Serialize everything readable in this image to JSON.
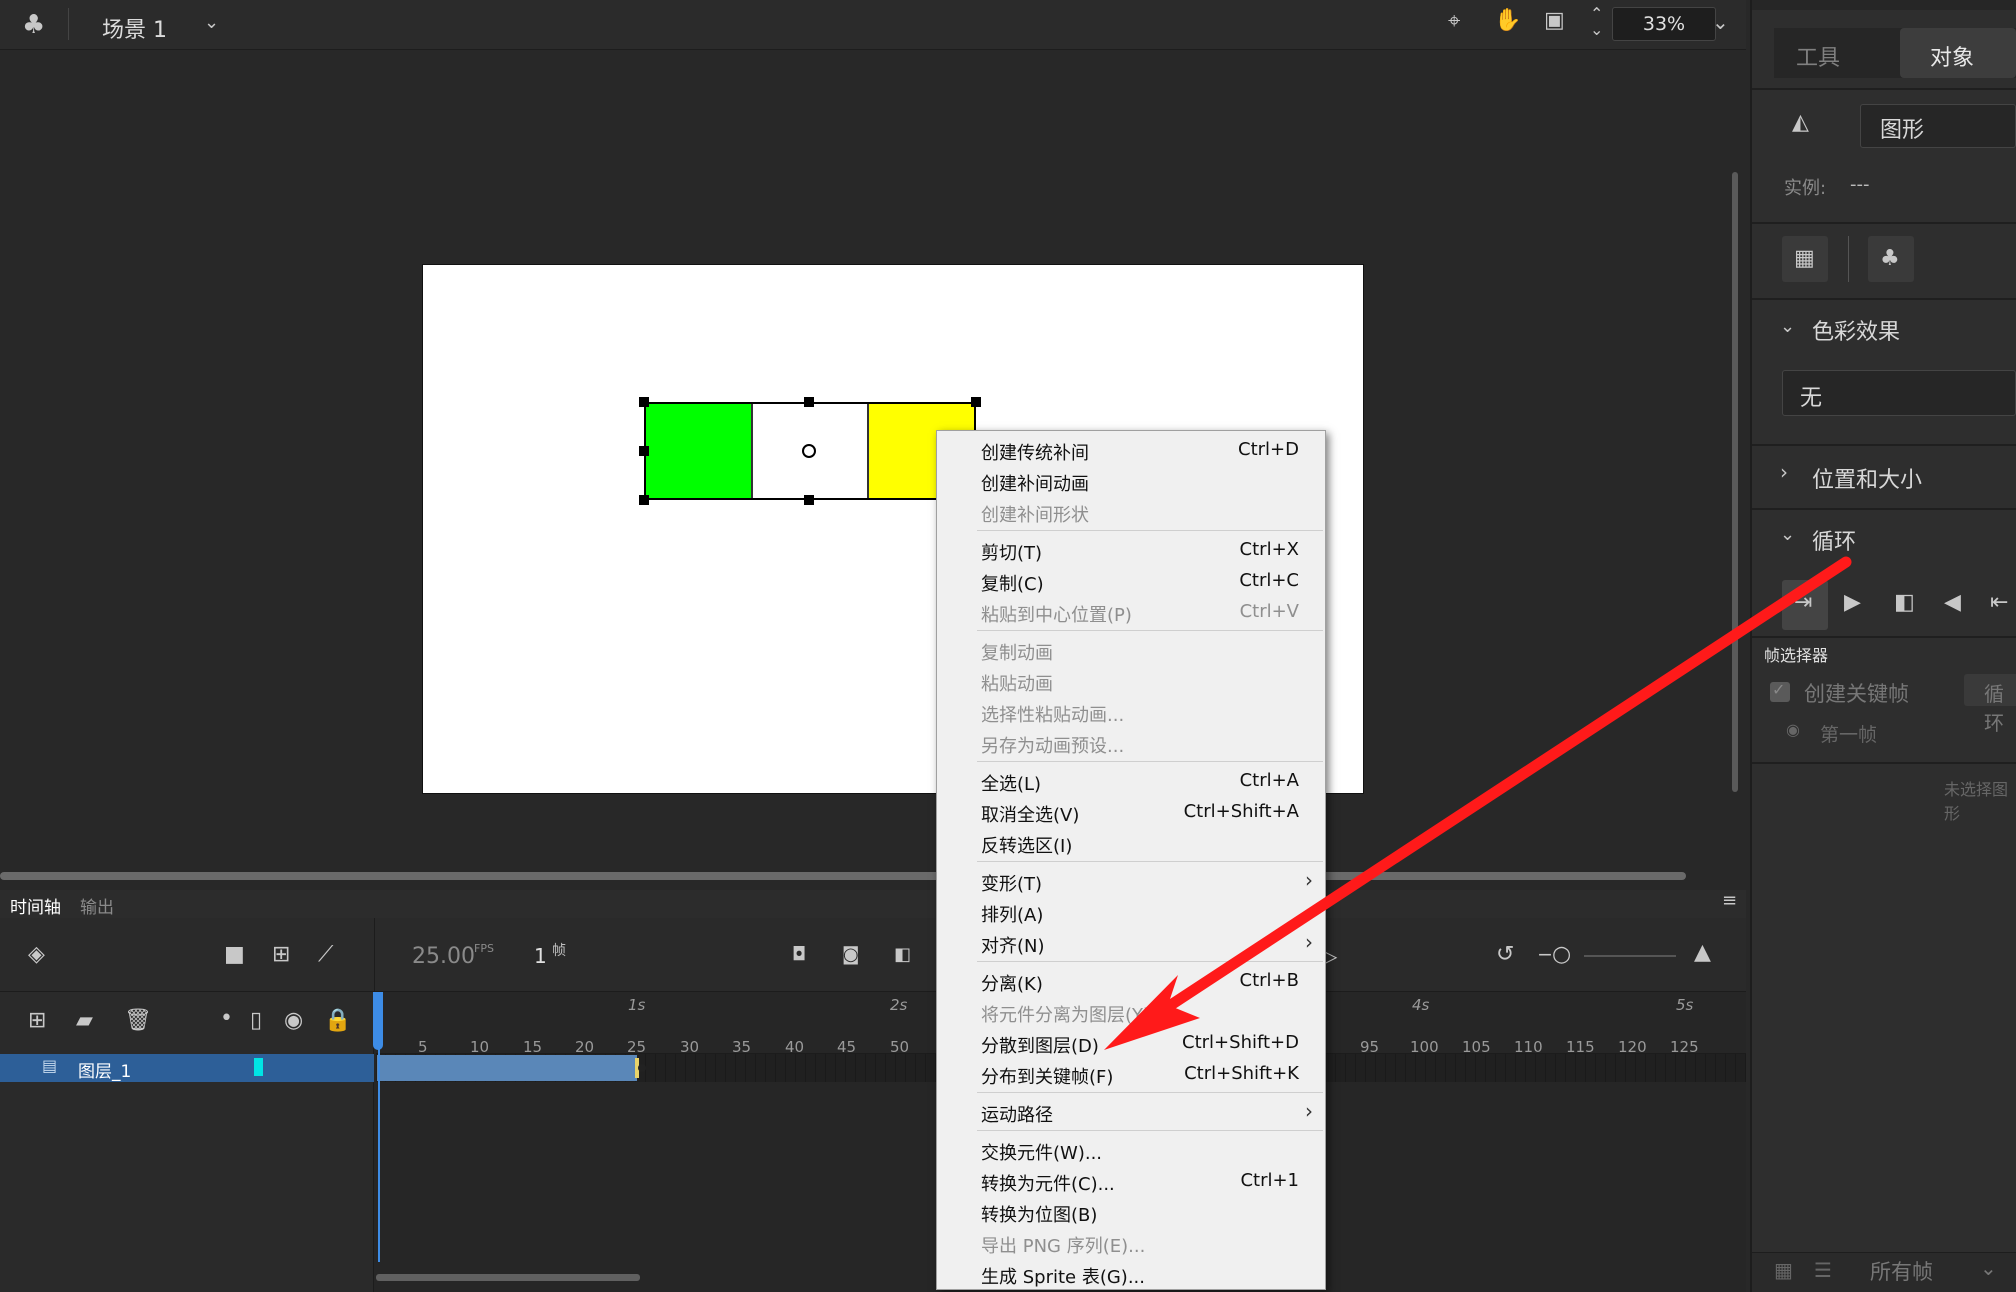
{
  "topbar": {
    "scene_label": "场景 1",
    "zoom": "33%"
  },
  "timeline": {
    "tab_timeline": "时间轴",
    "tab_output": "输出",
    "fps": "25.00",
    "fps_unit": "FPS",
    "frame": "1",
    "frame_unit": "帧",
    "layer_name": "图层_1",
    "seconds": [
      "1s",
      "2s",
      "4s",
      "5s"
    ],
    "ticks_left": [
      "5",
      "10",
      "15",
      "20",
      "25",
      "30",
      "35",
      "40",
      "45",
      "50"
    ],
    "ticks_right": [
      "95",
      "100",
      "105",
      "110",
      "115",
      "120",
      "125"
    ]
  },
  "props": {
    "tab_tool": "工具",
    "tab_object": "对象",
    "instance_type": "图形",
    "instance_label": "实例:",
    "instance_value": "---",
    "color_effect": "色彩效果",
    "color_effect_value": "无",
    "position_size": "位置和大小",
    "loop": "循环",
    "frame_picker": "帧选择器",
    "create_keyframe": "创建关键帧",
    "loop_btn": "循环",
    "first_frame": "第一帧",
    "no_selection": "未选择图形",
    "all_frames": "所有帧"
  },
  "menu": {
    "items": [
      {
        "label": "创建传统补间",
        "shortcut": "Ctrl+D",
        "disabled": false
      },
      {
        "label": "创建补间动画",
        "shortcut": "",
        "disabled": false
      },
      {
        "label": "创建补间形状",
        "shortcut": "",
        "disabled": true
      },
      {
        "label": "剪切(T)",
        "shortcut": "Ctrl+X",
        "disabled": false
      },
      {
        "label": "复制(C)",
        "shortcut": "Ctrl+C",
        "disabled": false
      },
      {
        "label": "粘贴到中心位置(P)",
        "shortcut": "Ctrl+V",
        "disabled": true
      },
      {
        "label": "复制动画",
        "shortcut": "",
        "disabled": true
      },
      {
        "label": "粘贴动画",
        "shortcut": "",
        "disabled": true
      },
      {
        "label": "选择性粘贴动画...",
        "shortcut": "",
        "disabled": true
      },
      {
        "label": "另存为动画预设...",
        "shortcut": "",
        "disabled": true
      },
      {
        "label": "全选(L)",
        "shortcut": "Ctrl+A",
        "disabled": false
      },
      {
        "label": "取消全选(V)",
        "shortcut": "Ctrl+Shift+A",
        "disabled": false
      },
      {
        "label": "反转选区(I)",
        "shortcut": "",
        "disabled": false
      },
      {
        "label": "变形(T)",
        "shortcut": "",
        "disabled": false,
        "submenu": true
      },
      {
        "label": "排列(A)",
        "shortcut": "",
        "disabled": false
      },
      {
        "label": "对齐(N)",
        "shortcut": "",
        "disabled": false,
        "submenu": true
      },
      {
        "label": "分离(K)",
        "shortcut": "Ctrl+B",
        "disabled": false
      },
      {
        "label": "将元件分离为图层(Y)",
        "shortcut": "",
        "disabled": true
      },
      {
        "label": "分散到图层(D)",
        "shortcut": "Ctrl+Shift+D",
        "disabled": false
      },
      {
        "label": "分布到关键帧(F)",
        "shortcut": "Ctrl+Shift+K",
        "disabled": false
      },
      {
        "label": "运动路径",
        "shortcut": "",
        "disabled": false,
        "submenu": true
      },
      {
        "label": "交换元件(W)...",
        "shortcut": "",
        "disabled": false
      },
      {
        "label": "转换为元件(C)...",
        "shortcut": "Ctrl+1",
        "disabled": false
      },
      {
        "label": "转换为位图(B)",
        "shortcut": "",
        "disabled": false
      },
      {
        "label": "导出 PNG 序列(E)...",
        "shortcut": "",
        "disabled": true
      },
      {
        "label": "生成 Sprite 表(G)...",
        "shortcut": "",
        "disabled": false
      }
    ],
    "submenu_glyph": "›"
  },
  "colors": {
    "green_rect": "#00ff00",
    "yellow_rect": "#ffff00",
    "accent_blue": "#2d5f98",
    "annotation_arrow": "#ff1a1a",
    "keyframe_cyan": "#00e5e5"
  },
  "icons": [
    "club-icon",
    "chevron-down-icon",
    "center-stage-icon",
    "hand-tool-icon",
    "clip-stage-icon",
    "stepper-icon",
    "camera-icon",
    "layer-depth-icon",
    "graph-icon",
    "add-layer-icon",
    "folder-icon",
    "trash-icon",
    "eye-hidden-icon",
    "lock-icon"
  ]
}
